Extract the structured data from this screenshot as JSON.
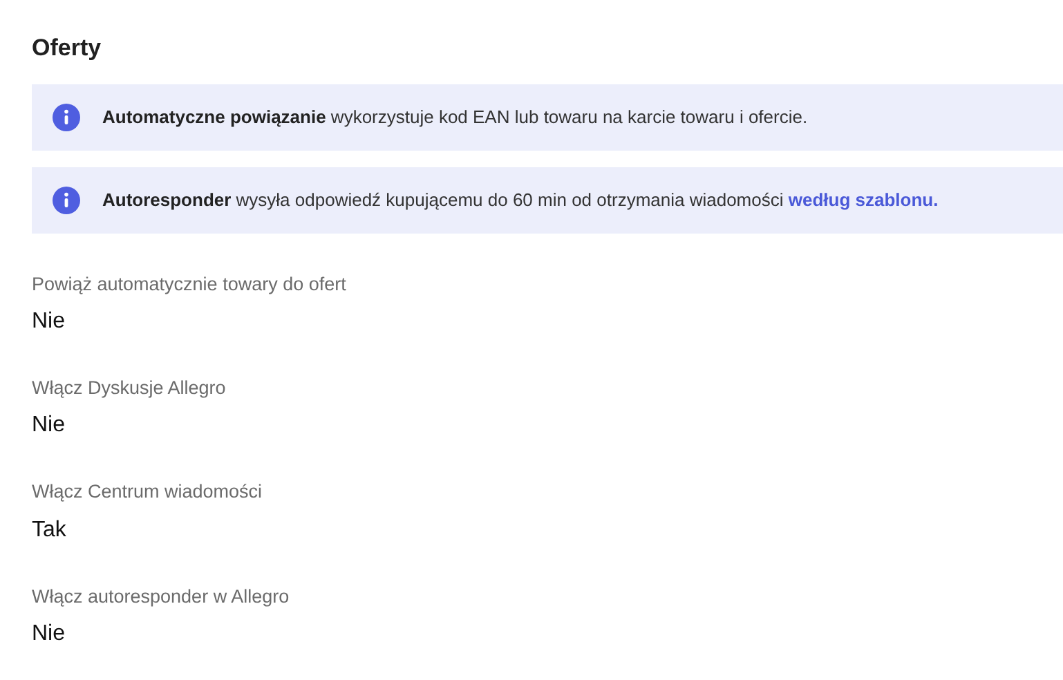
{
  "title": "Oferty",
  "notes": [
    {
      "text": "**Automatyczne powiązanie** wykorzystuje kod EAN lub towaru na karcie towaru i ofercie."
    },
    {
      "text": "**Autoresponder** wysyła odpowiedź kupującemu do 60 min od otrzymania wiadomości",
      "link": "według szablonu."
    }
  ],
  "settings": [
    {
      "label": "Powiąż automatycznie towary do ofert",
      "value": "Nie"
    },
    {
      "label": "Włącz Dyskusje Allegro",
      "value": "Nie"
    },
    {
      "label": "Włącz Centrum wiadomości",
      "value": "Tak"
    },
    {
      "label": "Włącz autoresponder w Allegro",
      "value": "Nie"
    }
  ]
}
